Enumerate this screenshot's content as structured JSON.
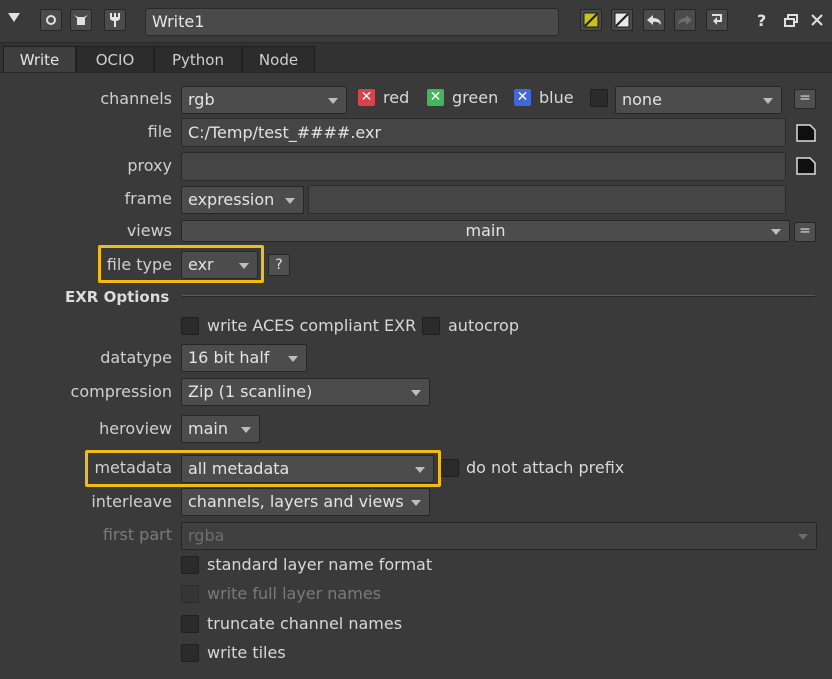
{
  "titlebar": {
    "node_name": "Write1",
    "help_glyph": "?",
    "icons": [
      "collapse-arrow-icon",
      "node-center-icon",
      "node-color-icon",
      "lock-wrench-icon",
      "yellow-swatch-icon",
      "white-swatch-icon",
      "undo-icon",
      "redo-icon",
      "revert-icon",
      "help-icon",
      "float-window-icon",
      "close-icon"
    ],
    "colors": {
      "node_tile": "#c8c21a",
      "panel_bg": "#3a3a3a",
      "highlight": "#f2bc12"
    }
  },
  "tabs": [
    "Write",
    "OCIO",
    "Python",
    "Node"
  ],
  "form": {
    "channels": {
      "label": "channels",
      "value": "rgb",
      "red": "red",
      "green": "green",
      "blue": "blue",
      "extra": "none",
      "eq": "="
    },
    "file": {
      "label": "file",
      "value": "C:/Temp/test_####.exr"
    },
    "proxy": {
      "label": "proxy",
      "value": ""
    },
    "frame": {
      "label": "frame",
      "mode": "expression",
      "value": ""
    },
    "views": {
      "label": "views",
      "value": "main",
      "eq": "="
    },
    "file_type": {
      "label": "file type",
      "value": "exr",
      "help": "?"
    },
    "section_title": "EXR Options",
    "write_aces": "write ACES compliant EXR",
    "autocrop": "autocrop",
    "datatype": {
      "label": "datatype",
      "value": "16 bit half"
    },
    "compression": {
      "label": "compression",
      "value": "Zip (1 scanline)"
    },
    "heroview": {
      "label": "heroview",
      "value": "main"
    },
    "metadata": {
      "label": "metadata",
      "value": "all metadata",
      "prefix": "do not attach prefix"
    },
    "interleave": {
      "label": "interleave",
      "value": "channels, layers and views"
    },
    "first_part": {
      "label": "first part",
      "value": "rgba"
    },
    "standard_layer": "standard layer name format",
    "write_full_layer": "write full layer names",
    "truncate": "truncate channel names",
    "write_tiles": "write tiles"
  },
  "channel_colors": {
    "red": "#d8434a",
    "green": "#3fb75a",
    "blue": "#4466d8"
  }
}
